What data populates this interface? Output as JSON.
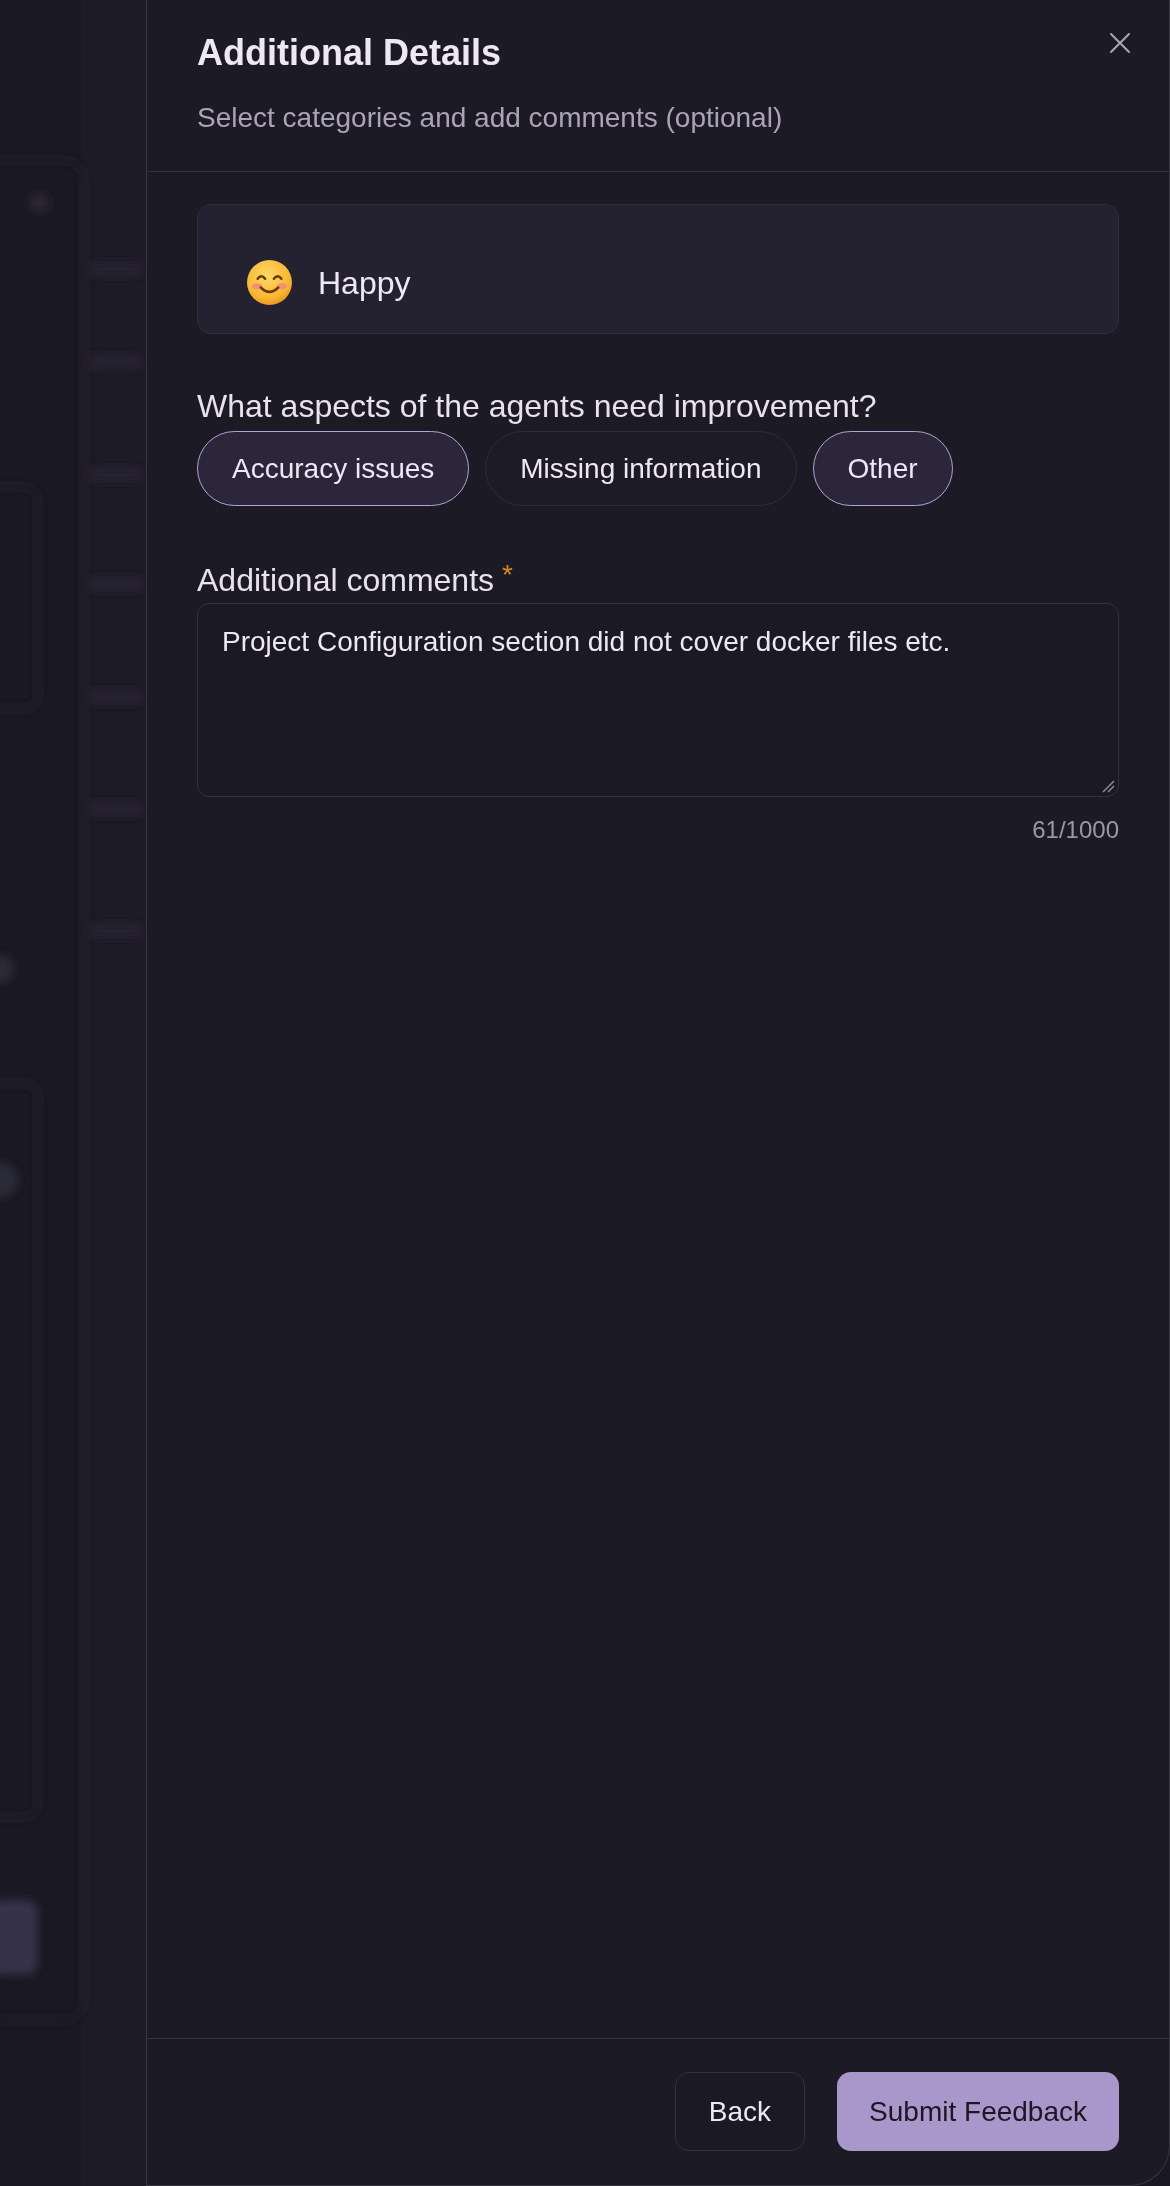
{
  "dialog": {
    "title": "Additional Details",
    "subtitle": "Select categories and add comments (optional)"
  },
  "mood": {
    "label": "Happy"
  },
  "question": "What aspects of the agents need improvement?",
  "categories": [
    {
      "label": "Accuracy issues",
      "selected": true
    },
    {
      "label": "Missing information",
      "selected": false
    },
    {
      "label": "Other",
      "selected": true
    }
  ],
  "comments": {
    "label": "Additional comments",
    "required_mark": "*",
    "value": "Project Configuration section did not cover docker files etc.",
    "counter": "61/1000"
  },
  "buttons": [
    {
      "label": "Back",
      "kind": "secondary"
    },
    {
      "label": "Submit Feedback",
      "kind": "primary"
    }
  ]
}
